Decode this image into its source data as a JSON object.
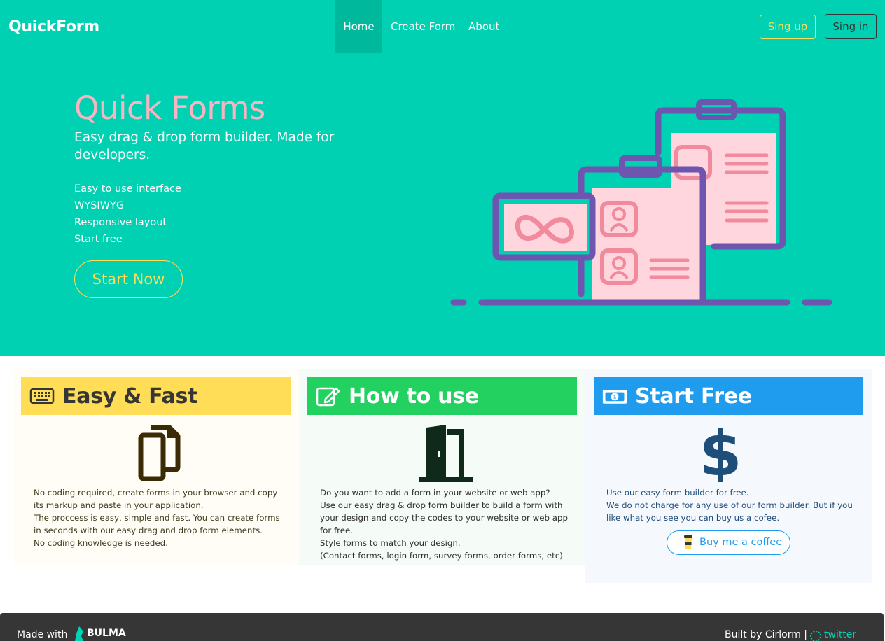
{
  "navbar": {
    "brand": "QuickForm",
    "links": [
      "Home",
      "Create Form",
      "About"
    ],
    "signup_label": "Sing up",
    "signin_label": "Sing in"
  },
  "hero": {
    "title": "Quick Forms",
    "subtitle": "Easy drag & drop form builder. Made for developers.",
    "features": [
      "Easy to use interface",
      "WYSIWYG",
      "Responsive layout",
      "Start free"
    ],
    "cta_label": "Start Now"
  },
  "cards": [
    {
      "title": "Easy & Fast",
      "head_icon": "keyboard-icon",
      "big_icon": "copy-icon",
      "lines": [
        "No coding required, create forms in your browser and copy its markup and paste in your application.",
        "The proccess is easy, simple and fast. You can create forms in seconds with our easy drag and drop form elements.",
        "No coding knowledge is needed."
      ]
    },
    {
      "title": "How to use",
      "head_icon": "edit-icon",
      "big_icon": "door-open-icon",
      "lines": [
        "Do you want to add a form in your website or web app?",
        "Use our easy drag & drop form builder to build a form with your design and copy the codes to your website or web app for free.",
        "Style forms to match your design.",
        "(Contact forms, login form, survey forms, order forms, etc)"
      ]
    },
    {
      "title": "Start Free",
      "head_icon": "money-bill-icon",
      "big_icon": "dollar-icon",
      "lines": [
        "Use our easy form builder for free.",
        "We do not charge for any use of our form builder. But if you like what you see you can buy us a cofee."
      ],
      "button_label": "Buy me a coffee"
    }
  ],
  "footer": {
    "made_with": "Made with",
    "bulma": "BULMA",
    "built_by": "Built by Cirlorm |",
    "twitter": "twitter"
  },
  "colors": {
    "primary": "#00d1b2",
    "warning": "#ffdd57",
    "success": "#23d160",
    "info": "#209cee",
    "pink": "#f8b4c2",
    "dark": "#363636"
  }
}
